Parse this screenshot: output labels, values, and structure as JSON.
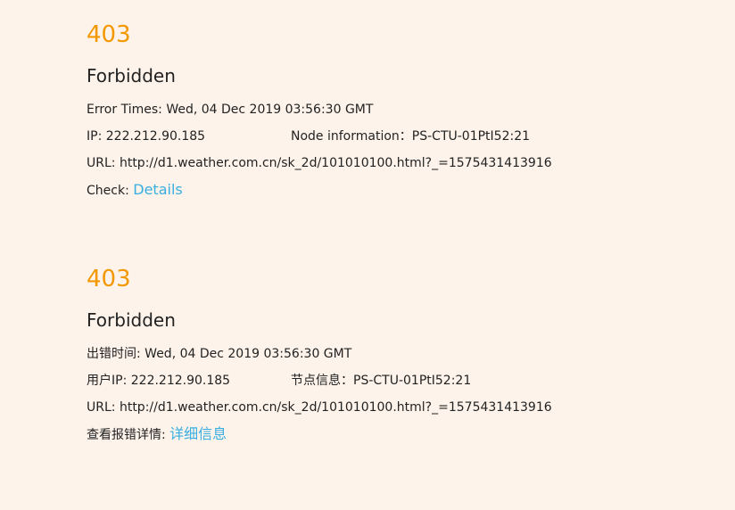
{
  "en": {
    "code": "403",
    "title": "Forbidden",
    "error_times_label": "Error Times:",
    "error_times_value": "Wed, 04 Dec 2019 03:56:30 GMT",
    "ip_label": "IP:",
    "ip_value": "222.212.90.185",
    "node_label": "Node information：",
    "node_value": "PS-CTU-01PtI52:21",
    "url_label": "URL:",
    "url_value": "http://d1.weather.com.cn/sk_2d/101010100.html?_=1575431413916",
    "check_label": "Check:",
    "check_link": "Details"
  },
  "cn": {
    "code": "403",
    "title": "Forbidden",
    "error_times_label": "出错时间:",
    "error_times_value": "Wed, 04 Dec 2019 03:56:30 GMT",
    "ip_label": "用户IP:",
    "ip_value": "222.212.90.185",
    "node_label": "节点信息：",
    "node_value": "PS-CTU-01PtI52:21",
    "url_label": "URL:",
    "url_value": "http://d1.weather.com.cn/sk_2d/101010100.html?_=1575431413916",
    "check_label": "查看报错详情:",
    "check_link": "详细信息"
  },
  "colors": {
    "background": "#fdf3ea",
    "code": "#f39800",
    "link": "#3aaee0",
    "text": "#222222"
  }
}
